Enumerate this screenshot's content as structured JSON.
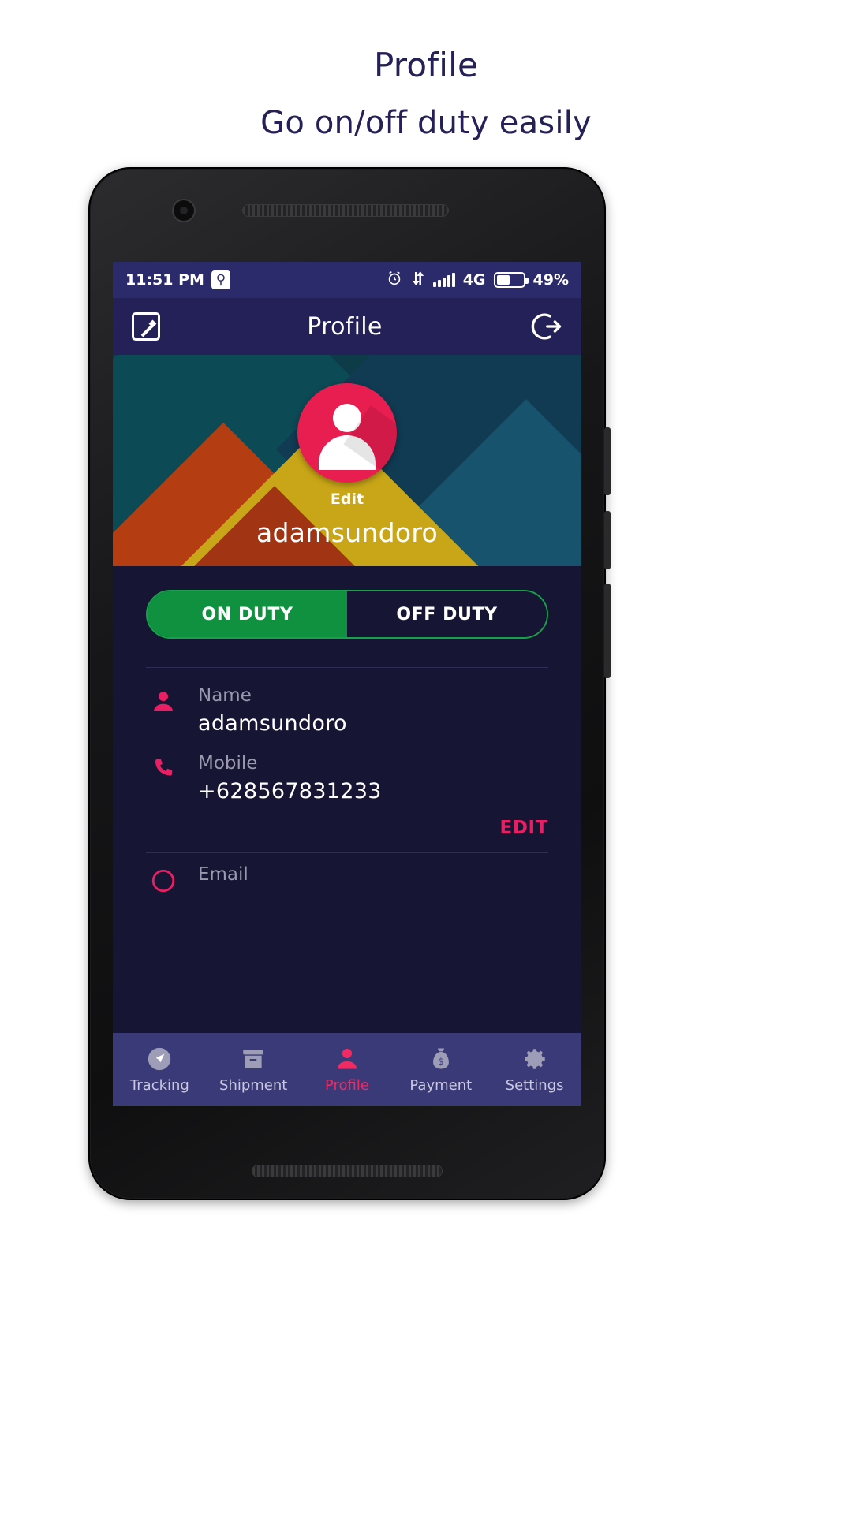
{
  "promo": {
    "title": "Profile",
    "subtitle": "Go on/off duty easily"
  },
  "status_bar": {
    "time": "11:51 PM",
    "sync_icon": "sync-icon",
    "alarm_icon": "alarm-icon",
    "data_transfer_icon": "data-transfer-icon",
    "signal_icon": "signal-bars-icon",
    "network": "4G",
    "battery_icon": "battery-icon",
    "battery_percent": "49%"
  },
  "app_bar": {
    "title": "Profile",
    "left_icon": "edit-square-icon",
    "right_icon": "logout-icon"
  },
  "banner": {
    "avatar_icon": "person-avatar-icon",
    "edit_label": "Edit",
    "name": "adamsundoro"
  },
  "duty": {
    "on_label": "ON DUTY",
    "off_label": "OFF DUTY",
    "active": "ON DUTY"
  },
  "fields": [
    {
      "icon": "person-icon",
      "label": "Name",
      "value": "adamsundoro"
    },
    {
      "icon": "phone-icon",
      "label": "Mobile",
      "value": "+628567831233"
    },
    {
      "icon": "email-icon",
      "label": "Email",
      "value": ""
    }
  ],
  "edit_link": "EDIT",
  "bottom_nav": [
    {
      "icon": "navigation-arrow-icon",
      "label": "Tracking",
      "active": false
    },
    {
      "icon": "box-icon",
      "label": "Shipment",
      "active": false
    },
    {
      "icon": "person-icon",
      "label": "Profile",
      "active": true
    },
    {
      "icon": "money-bag-icon",
      "label": "Payment",
      "active": false
    },
    {
      "icon": "gear-icon",
      "label": "Settings",
      "active": false
    }
  ],
  "colors": {
    "promo_text": "#252055",
    "app_bar": "#242058",
    "status_bar": "#2b2a6a",
    "screen_bg": "#161533",
    "accent_pink": "#e91e63",
    "duty_green": "#10913f",
    "nav_bg": "#3b3a79"
  }
}
